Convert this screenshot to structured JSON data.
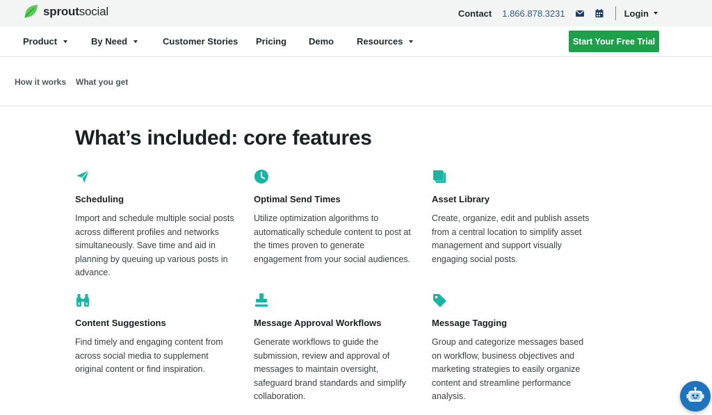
{
  "brand": {
    "name_bold": "sprout",
    "name_rest": "social"
  },
  "utility": {
    "contact_label": "Contact",
    "phone": "1.866.878.3231",
    "login_label": "Login"
  },
  "nav": {
    "items": [
      {
        "label": "Product",
        "dropdown": true
      },
      {
        "label": "By Need",
        "dropdown": true
      },
      {
        "label": "Customer Stories",
        "dropdown": false
      },
      {
        "label": "Pricing",
        "dropdown": false
      },
      {
        "label": "Demo",
        "dropdown": false
      },
      {
        "label": "Resources",
        "dropdown": true
      }
    ],
    "cta_label": "Start Your Free Trial"
  },
  "subnav": {
    "items": [
      "How it works",
      "What you get"
    ]
  },
  "main": {
    "heading": "What’s included: core features",
    "features": [
      {
        "icon": "paper-plane-icon",
        "title": "Scheduling",
        "description": "Import and schedule multiple social posts across different profiles and networks simultaneously. Save time and aid in planning by queuing up various posts in advance."
      },
      {
        "icon": "clock-icon",
        "title": "Optimal Send Times",
        "description": "Utilize optimization algorithms to automatically schedule content to post at the times proven to generate engagement from your social audiences."
      },
      {
        "icon": "stacked-files-icon",
        "title": "Asset Library",
        "description": "Create, organize, edit and publish assets from a central location to simplify asset management and support visually engaging social posts."
      },
      {
        "icon": "binoculars-icon",
        "title": "Content Suggestions",
        "description": "Find timely and engaging content from across social media to supplement original content or find inspiration."
      },
      {
        "icon": "stamp-icon",
        "title": "Message Approval Workflows",
        "description": "Generate workflows to guide the submission, review and approval of messages to maintain oversight, safeguard brand standards and simplify collaboration."
      },
      {
        "icon": "tag-icon",
        "title": "Message Tagging",
        "description": "Group and categorize messages based on workflow, business objectives and marketing strategies to easily organize content and streamline performance analysis."
      }
    ]
  },
  "colors": {
    "accent": "#1f9e4b",
    "icon_teal": "#19b4a5",
    "phone_link": "#2b5b8a",
    "chat_bot": "#1e73be"
  }
}
